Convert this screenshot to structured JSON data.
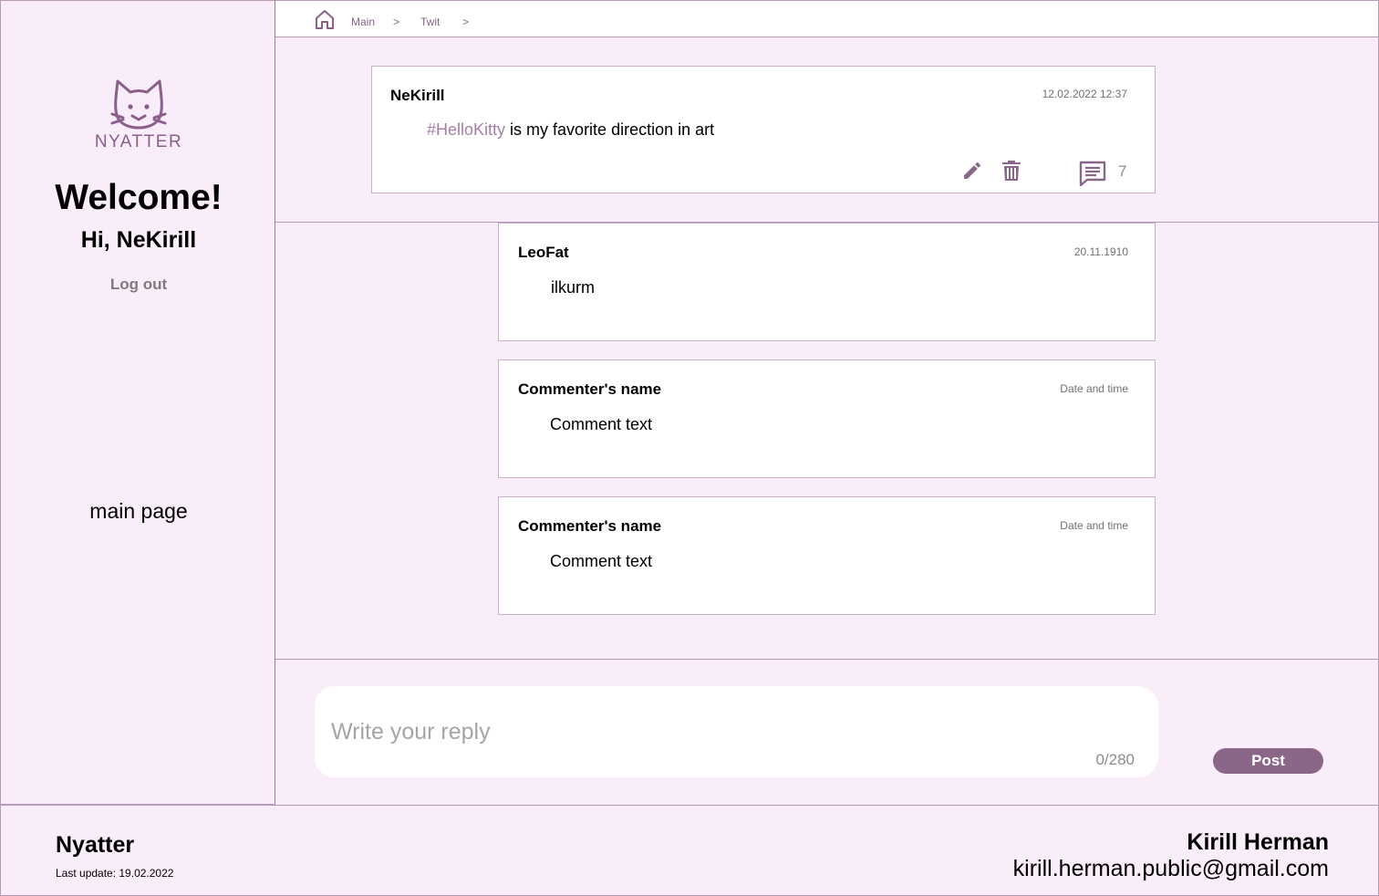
{
  "sidebar": {
    "logo_text": "NYATTER",
    "welcome": "Welcome!",
    "greeting": "Hi, NeKirill",
    "logout_label": "Log out",
    "main_page_label": "main page"
  },
  "breadcrumb": {
    "items": [
      "Main",
      "Twit"
    ],
    "separator": ">"
  },
  "post": {
    "author": "NeKirill",
    "datetime": "12.02.2022 12:37",
    "hashtag": "#HelloKitty",
    "text": " is my favorite direction in art",
    "comments_count": "7"
  },
  "comments": [
    {
      "author": "LeoFat",
      "datetime": "20.11.1910",
      "text": "ilkurm"
    },
    {
      "author": "Commenter's name",
      "datetime": "Date and time",
      "text": "Comment text"
    },
    {
      "author": "Commenter's name",
      "datetime": "Date and time",
      "text": "Comment text"
    }
  ],
  "reply": {
    "placeholder": "Write your reply",
    "char_count": "0/280",
    "post_label": "Post"
  },
  "footer": {
    "brand": "Nyatter",
    "last_update": "Last update: 19.02.2022",
    "author_name": "Kirill Herman",
    "author_email": "kirill.herman.public@gmail.com"
  },
  "colors": {
    "background": "#f9edf9",
    "accent": "#8a6789",
    "hashtag": "#a77ea7",
    "border": "#b79ab7"
  },
  "icons": [
    "cat-logo-icon",
    "home-icon",
    "edit-icon",
    "delete-icon",
    "comment-icon"
  ]
}
